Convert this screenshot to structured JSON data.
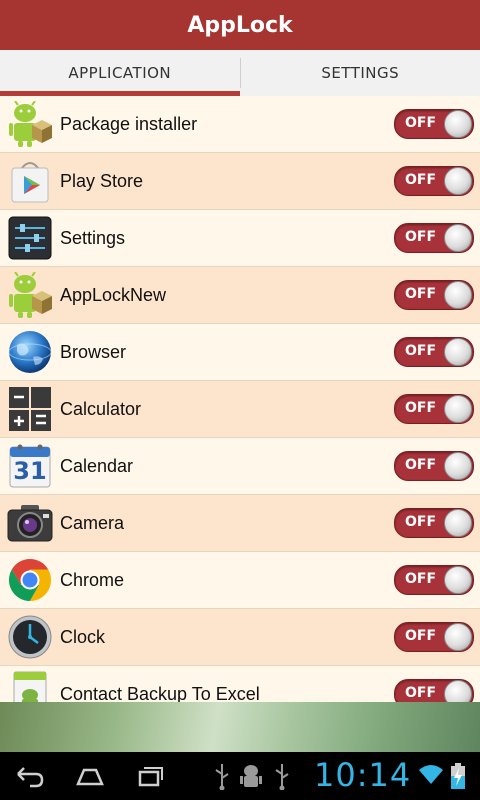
{
  "app": {
    "title": "AppLock"
  },
  "tabs": [
    {
      "label": "APPLICATION",
      "active": true
    },
    {
      "label": "SETTINGS",
      "active": false
    }
  ],
  "apps": [
    {
      "name": "Package installer",
      "icon": "android-package-icon",
      "state": "OFF"
    },
    {
      "name": "Play Store",
      "icon": "play-store-icon",
      "state": "OFF"
    },
    {
      "name": "Settings",
      "icon": "settings-sliders-icon",
      "state": "OFF"
    },
    {
      "name": "AppLockNew",
      "icon": "android-package-icon",
      "state": "OFF"
    },
    {
      "name": "Browser",
      "icon": "globe-icon",
      "state": "OFF"
    },
    {
      "name": "Calculator",
      "icon": "calculator-icon",
      "state": "OFF"
    },
    {
      "name": "Calendar",
      "icon": "calendar-icon",
      "state": "OFF"
    },
    {
      "name": "Camera",
      "icon": "camera-icon",
      "state": "OFF"
    },
    {
      "name": "Chrome",
      "icon": "chrome-icon",
      "state": "OFF"
    },
    {
      "name": "Clock",
      "icon": "clock-icon",
      "state": "OFF"
    },
    {
      "name": "Contact Backup To Excel",
      "icon": "android-file-icon",
      "state": "OFF"
    }
  ],
  "calendar_icon_day": "31",
  "status_bar": {
    "time": "10:14"
  },
  "colors": {
    "accent": "#a63430",
    "toggle_off": "#a8323a",
    "clock": "#33b5e5"
  }
}
